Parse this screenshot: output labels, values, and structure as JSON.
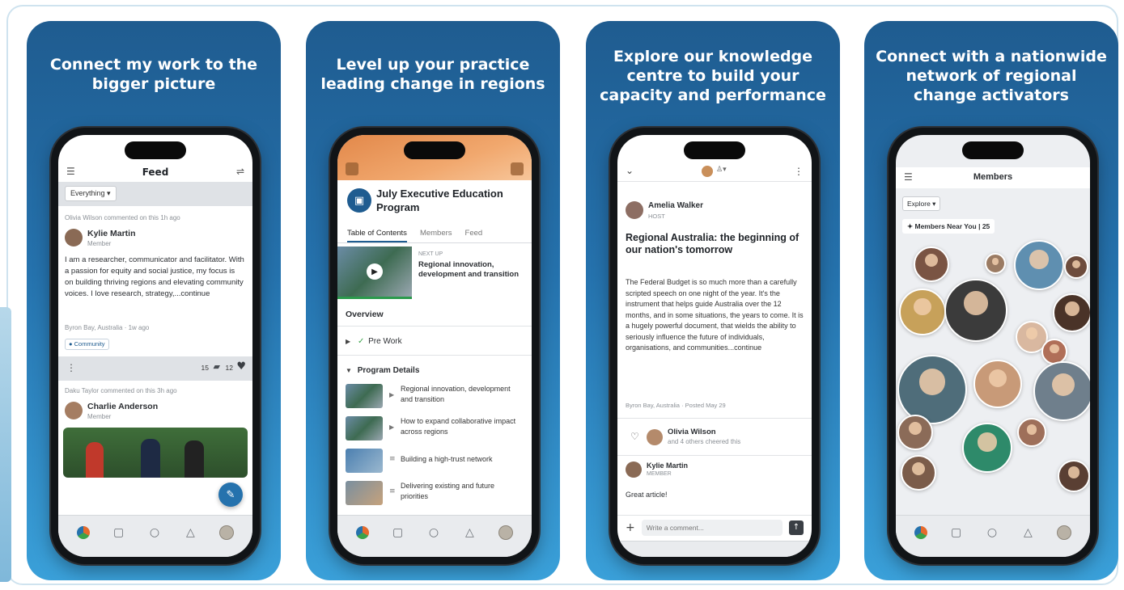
{
  "panels": [
    {
      "title": "Connect my work to the bigger picture",
      "screen": {
        "header_title": "Feed",
        "filter_label": "Everything ▾",
        "post1": {
          "activity": "Olivia Wilson commented on this 1h ago",
          "author": "Kylie Martin",
          "role": "Member",
          "body": "I am a researcher, communicator and facilitator. With a passion for equity and social justice, my focus is on building thriving regions and elevating community voices. I love research, strategy,...continue",
          "location": "Byron Bay, Australia",
          "time": "1w ago",
          "tag": "Community",
          "comments": "15",
          "likes": "12"
        },
        "post2": {
          "activity": "Daku Taylor commented on this 3h ago",
          "author": "Charlie Anderson",
          "role": "Member"
        }
      }
    },
    {
      "title": "Level up your practice leading change in regions",
      "screen": {
        "program_title": "July Executive Education Program",
        "tabs": [
          "Table of Contents",
          "Members",
          "Feed"
        ],
        "next_up_label": "NEXT UP",
        "next_up_title": "Regional innovation, development and transition",
        "overview_label": "Overview",
        "pre_work_label": "Pre Work",
        "program_details_label": "Program Details",
        "items": [
          "Regional innovation, development and transition",
          "How to expand collaborative impact across regions",
          "Building a high-trust network",
          "Delivering existing and future priorities"
        ]
      }
    },
    {
      "title": "Explore our knowledge centre to build your capacity and performance",
      "screen": {
        "author": "Amelia Walker",
        "author_role": "HOST",
        "article_title": "Regional Australia: the beginning of our nation's tomorrow",
        "article_body": "The Federal Budget is so much more than a carefully scripted speech on one night of the year. It's the instrument that helps guide Australia over the 12 months, and in some situations, the years to come.  It is a hugely powerful document, that wields the ability to seriously influence the future of individuals, organisations, and communities...continue",
        "location": "Byron Bay, Australia",
        "posted": "Posted May 29",
        "cheer_name": "Olivia Wilson",
        "cheer_text": "and 4 others cheered this",
        "commenter": "Kylie Martin",
        "commenter_role": "MEMBER",
        "comment": "Great article!",
        "compose_placeholder": "Write a comment..."
      }
    },
    {
      "title": "Connect with a nationwide network of regional change activators",
      "screen": {
        "header_title": "Members",
        "explore_label": "Explore ▾",
        "near_label": "Members Near You | 25"
      }
    }
  ]
}
